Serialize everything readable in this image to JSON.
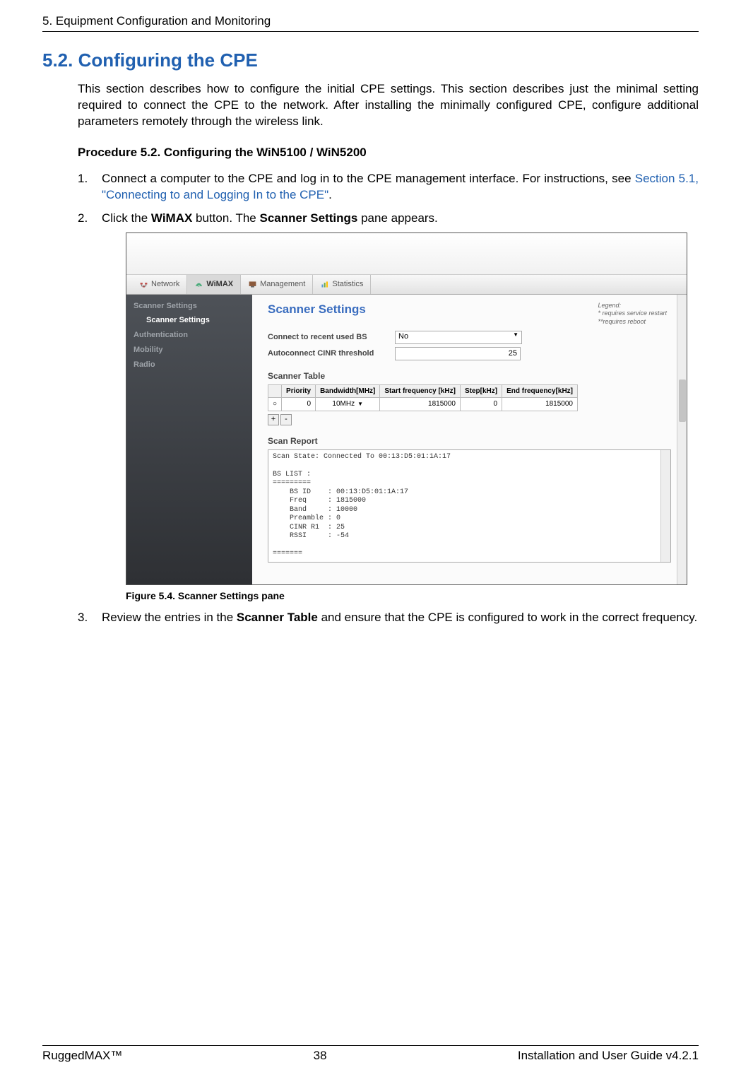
{
  "chapter_header": "5. Equipment Configuration and Monitoring",
  "section_heading": "5.2. Configuring the CPE",
  "intro": "This section describes how to configure the initial CPE settings. This section describes just the minimal setting required to connect the CPE to the network. After installing the minimally configured CPE, configure additional parameters remotely through the wireless link.",
  "procedure_heading": "Procedure 5.2. Configuring the WiN5100 / WiN5200",
  "steps": {
    "1": {
      "num": "1.",
      "pre": "Connect a computer to the CPE and log in to the CPE management interface. For instructions, see ",
      "link": "Section 5.1, \"Connecting to and Logging In to the CPE\"",
      "post": "."
    },
    "2": {
      "num": "2.",
      "pre": "Click the ",
      "b1": "WiMAX",
      "mid": " button. The ",
      "b2": "Scanner Settings",
      "post": " pane appears."
    },
    "3": {
      "num": "3.",
      "pre": "Review the entries in the ",
      "b1": "Scanner Table",
      "post": " and ensure that the CPE is configured to work in the correct frequency."
    }
  },
  "figure_caption": "Figure 5.4. Scanner Settings pane",
  "footer": {
    "left": "RuggedMAX™",
    "center": "38",
    "right": "Installation and User Guide v4.2.1"
  },
  "shot": {
    "nav": {
      "network": "Network",
      "wimax": "WiMAX",
      "management": "Management",
      "statistics": "Statistics"
    },
    "sidebar": {
      "scanner_settings": "Scanner Settings",
      "scanner_settings_sub": "Scanner Settings",
      "authentication": "Authentication",
      "mobility": "Mobility",
      "radio": "Radio"
    },
    "main": {
      "title": "Scanner Settings",
      "legend_title": "Legend:",
      "legend_line1": "* requires service restart",
      "legend_line2": "**requires reboot",
      "connect_label": "Connect to recent used BS",
      "connect_value": "No",
      "autoconnect_label": "Autoconnect CINR threshold",
      "autoconnect_value": "25",
      "scanner_table_heading": "Scanner Table",
      "table": {
        "h0": "",
        "h1": "Priority",
        "h2": "Bandwidth[MHz]",
        "h3": "Start frequency [kHz]",
        "h4": "Step[kHz]",
        "h5": "End frequency[kHz]",
        "r0": {
          "c0": "○",
          "c1": "0",
          "c2": "10MHz",
          "c3": "1815000",
          "c4": "0",
          "c5": "1815000"
        }
      },
      "plus": "+",
      "minus": "-",
      "scan_report_heading": "Scan Report",
      "report": "Scan State: Connected To 00:13:D5:01:1A:17\n\nBS LIST :\n=========\n    BS ID    : 00:13:D5:01:1A:17\n    Freq     : 1815000\n    Band     : 10000\n    Preamble : 0\n    CINR R1  : 25\n    RSSI     : -54\n\n======="
    }
  }
}
